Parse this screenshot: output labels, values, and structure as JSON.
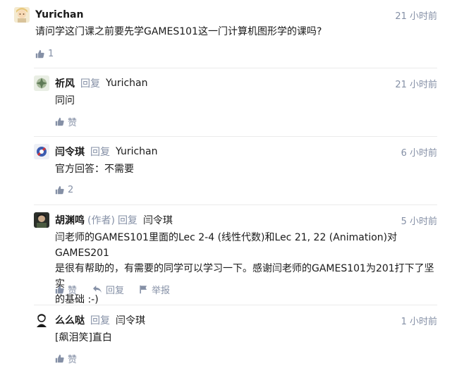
{
  "comments": [
    {
      "author": "Yurichan",
      "time": "21 小时前",
      "content": "请问学这门课之前要先学GAMES101这一门计算机图形学的课吗?",
      "likes": "1"
    },
    {
      "author": "祈风",
      "reply_word": "回复",
      "reply_to": "Yurichan",
      "time": "21 小时前",
      "content": "同问",
      "like_label": "赞"
    },
    {
      "author": "闫令琪",
      "reply_word": "回复",
      "reply_to": "Yurichan",
      "time": "6 小时前",
      "content": "官方回答：不需要",
      "likes": "2"
    },
    {
      "author": "胡渊鸣",
      "author_tag": "(作者)",
      "reply_word": "回复",
      "reply_to": "闫令琪",
      "time": "5 小时前",
      "content_lines": [
        "闫老师的GAMES101里面的Lec 2-4 (线性代数)和Lec 21, 22 (Animation)对GAMES201",
        "是很有帮助的，有需要的同学可以学习一下。感谢闫老师的GAMES101为201打下了坚实",
        "的基础 :-)"
      ],
      "like_label": "赞",
      "reply_label": "回复",
      "report_label": "举报"
    },
    {
      "author": "么么哒",
      "reply_word": "回复",
      "reply_to": "闫令琪",
      "time": "1 小时前",
      "content": "[飙泪笑]直白",
      "like_label": "赞"
    }
  ],
  "colors": {
    "meta": "#8590a6",
    "divider": "#ebebeb",
    "text": "#1a1a1a"
  },
  "icons": [
    "thumb-up-icon",
    "reply-icon",
    "flag-icon"
  ]
}
